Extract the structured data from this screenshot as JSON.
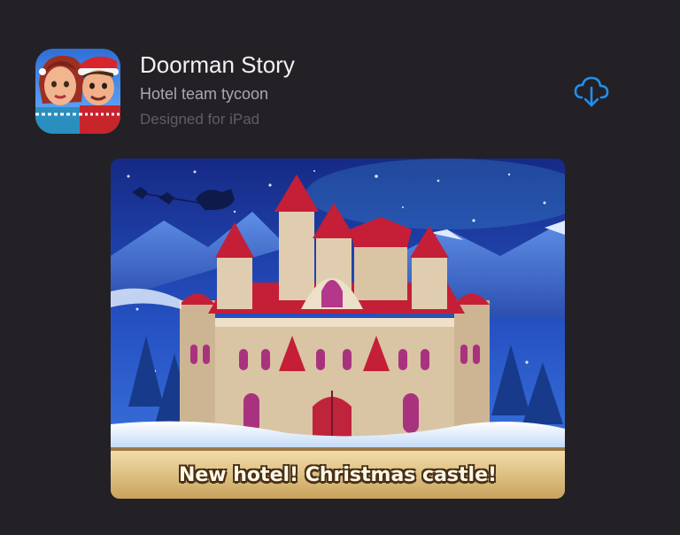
{
  "app": {
    "title": "Doorman Story",
    "subtitle": "Hotel team tycoon",
    "platform": "Designed for iPad"
  },
  "icons": {
    "download": "cloud-download-icon",
    "app_icon": "app-icon"
  },
  "screenshot": {
    "banner_text": "New hotel! Christmas castle!"
  },
  "colors": {
    "background": "#232125",
    "accent": "#1f8ff0",
    "title": "#f2f2f2",
    "subtitle": "#a9a9ad",
    "platform": "#5f5e63"
  }
}
